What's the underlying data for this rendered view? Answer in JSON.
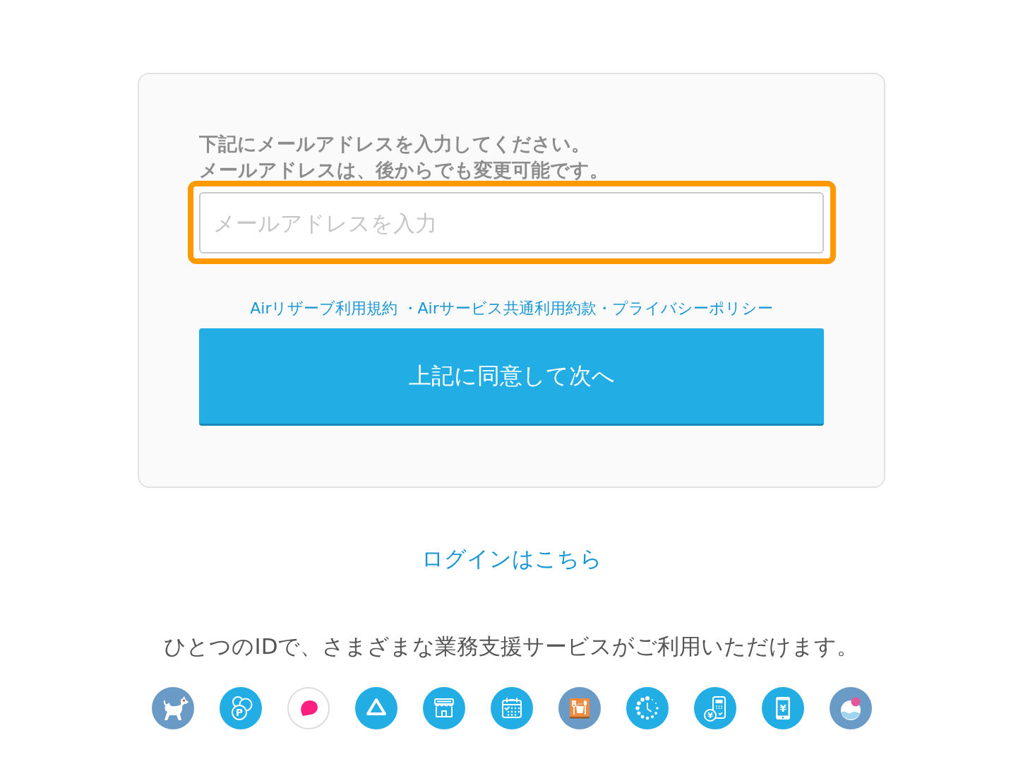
{
  "instructions": [
    "下記にメールアドレスを入力してください。",
    "メールアドレスは、後からでも変更可能です。"
  ],
  "email_field": {
    "placeholder": "メールアドレスを入力",
    "highlighted": true
  },
  "terms_links": [
    {
      "kind": "link",
      "text": "Airリザーブ利用規約"
    },
    {
      "kind": "separator",
      "text": "・"
    },
    {
      "kind": "link",
      "text": "Airサービス共通利用約款"
    },
    {
      "kind": "separator",
      "text": "・"
    },
    {
      "kind": "link",
      "text": "プライバシーポリシー"
    }
  ],
  "agree_button": {
    "label": "上記に同意して次へ"
  },
  "login_link": {
    "text": "ログインはこちら"
  },
  "tagline": "ひとつのIDで、さまざまな業務支援サービスがご利用いただけます。",
  "services": [
    {
      "kind": "dog"
    },
    {
      "kind": "coins",
      "symbol": "P"
    },
    {
      "kind": "bubble"
    },
    {
      "kind": "triangle"
    },
    {
      "kind": "store"
    },
    {
      "kind": "calendar"
    },
    {
      "kind": "restaurant"
    },
    {
      "kind": "clock"
    },
    {
      "kind": "terminal",
      "symbol": "¥"
    },
    {
      "kind": "phone",
      "symbol": "¥"
    },
    {
      "kind": "drop"
    }
  ]
}
